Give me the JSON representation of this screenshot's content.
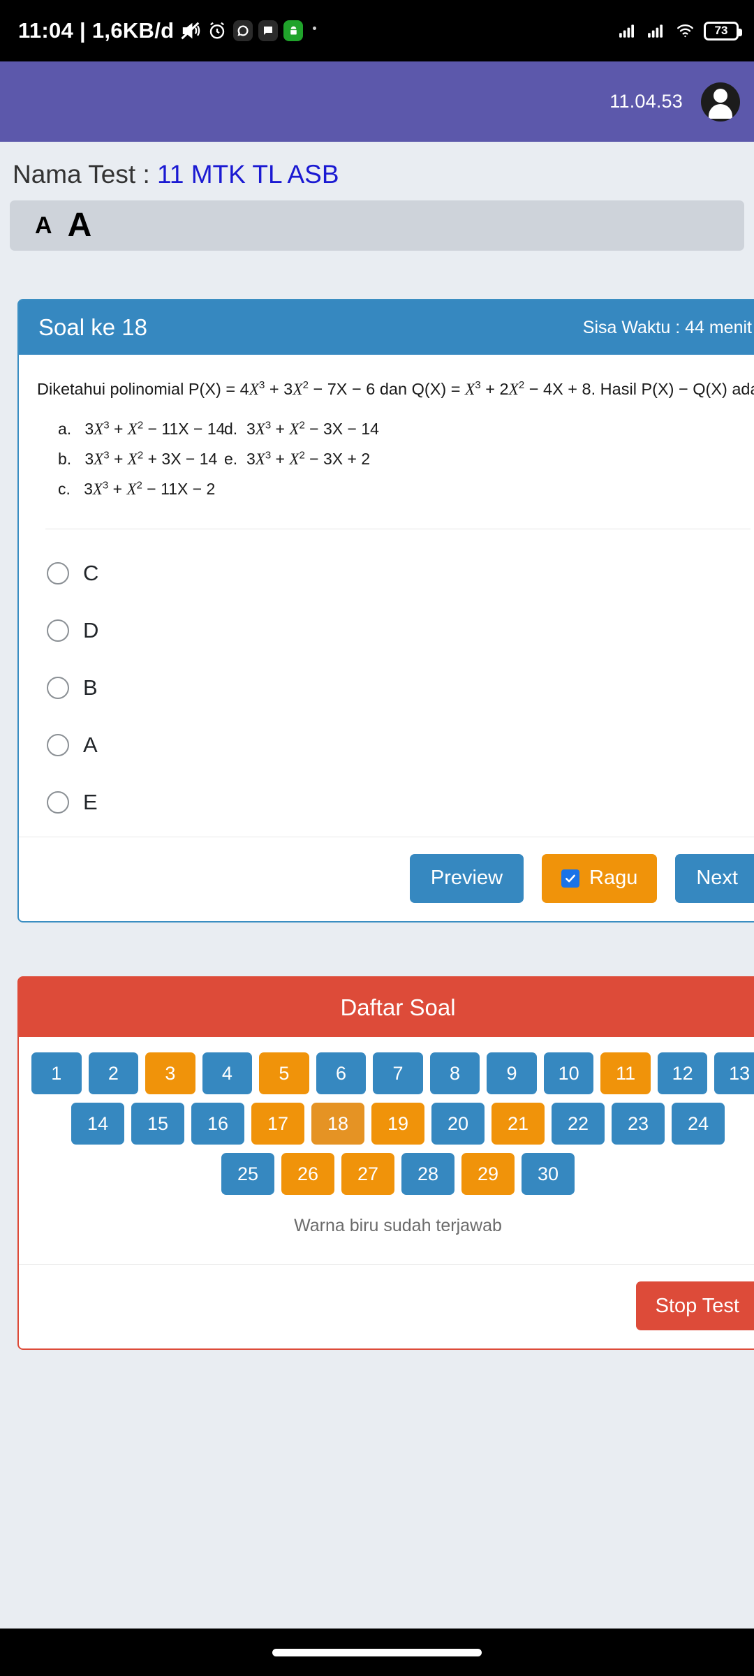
{
  "statusbar": {
    "clock": "11:04 | 1,6KB/d",
    "icons": [
      "mute-icon",
      "alarm-icon",
      "whatsapp-icon",
      "chat-icon",
      "android-icon"
    ],
    "battery_level": "73",
    "signal_icons": [
      "signal-bars-icon",
      "signal-bars-icon",
      "wifi-icon"
    ]
  },
  "appbar": {
    "time": "11.04.53",
    "avatar": "user-avatar-icon"
  },
  "test": {
    "name_label": "Nama Test : ",
    "name_value": "11 MTK TL ASB"
  },
  "fontbar": {
    "decrease_label": "A",
    "increase_label": "A"
  },
  "question_card": {
    "title": "Soal ke 18",
    "timer": "Sisa Waktu : 44 menit",
    "question_html": "Diketahui polinomial P(X) = 4<i>X</i><sup>3</sup> + 3<i>X</i><sup>2</sup> &minus; 7X &minus; 6 dan Q(X) = <i>X</i><sup>3</sup> + 2<i>X</i><sup>2</sup> &minus;  4X + 8. Hasil P(X) &minus; Q(X) adalah ...",
    "question_text": "Diketahui polinomial P(X) = 4X3 + 3X2 − 7X − 6 dan Q(X) = X3 + 2X2 − 4X + 8. Hasil P(X) − Q(X) adalah ...",
    "choices": [
      {
        "key": "a.",
        "html": "3<i>X</i><sup>3</sup> + <i>X</i><sup>2</sup> &minus; 11X &minus; 14",
        "text": "3X3 + X2 − 11X − 14"
      },
      {
        "key": "b.",
        "html": "3<i>X</i><sup>3</sup> + <i>X</i><sup>2</sup> + 3X &minus; 14",
        "text": "3X3 + X2 + 3X − 14"
      },
      {
        "key": "c.",
        "html": "3<i>X</i><sup>3</sup> + <i>X</i><sup>2</sup> &minus; 11X &minus; 2",
        "text": "3X3 + X2 − 11X − 2"
      },
      {
        "key": "d.",
        "html": "3<i>X</i><sup>3</sup> + <i>X</i><sup>2</sup> &minus; 3X &minus; 14",
        "text": "3X3 + X2 − 3X − 14"
      },
      {
        "key": "e.",
        "html": "3<i>X</i><sup>3</sup> + <i>X</i><sup>2</sup> &minus; 3X + 2",
        "text": "3X3 + X2 − 3X + 2"
      }
    ],
    "answers": [
      {
        "label": "C",
        "selected": false
      },
      {
        "label": "D",
        "selected": false
      },
      {
        "label": "B",
        "selected": false
      },
      {
        "label": "A",
        "selected": false
      },
      {
        "label": "E",
        "selected": false
      }
    ],
    "buttons": {
      "preview": "Preview",
      "ragu": "Ragu",
      "ragu_checked": true,
      "next": "Next"
    }
  },
  "daftar_soal": {
    "title": "Daftar Soal",
    "legend": "Warna biru sudah terjawab",
    "stop_button": "Stop Test",
    "rows": [
      [
        {
          "n": "1",
          "state": "blue"
        },
        {
          "n": "2",
          "state": "blue"
        },
        {
          "n": "3",
          "state": "orange"
        },
        {
          "n": "4",
          "state": "blue"
        },
        {
          "n": "5",
          "state": "orange"
        },
        {
          "n": "6",
          "state": "blue"
        },
        {
          "n": "7",
          "state": "blue"
        },
        {
          "n": "8",
          "state": "blue"
        },
        {
          "n": "9",
          "state": "blue"
        },
        {
          "n": "10",
          "state": "blue"
        },
        {
          "n": "11",
          "state": "orange"
        },
        {
          "n": "12",
          "state": "blue"
        },
        {
          "n": "13",
          "state": "blue"
        }
      ],
      [
        {
          "n": "14",
          "state": "blue"
        },
        {
          "n": "15",
          "state": "blue"
        },
        {
          "n": "16",
          "state": "blue"
        },
        {
          "n": "17",
          "state": "orange"
        },
        {
          "n": "18",
          "state": "current"
        },
        {
          "n": "19",
          "state": "orange"
        },
        {
          "n": "20",
          "state": "blue"
        },
        {
          "n": "21",
          "state": "orange"
        },
        {
          "n": "22",
          "state": "blue"
        },
        {
          "n": "23",
          "state": "blue"
        },
        {
          "n": "24",
          "state": "blue"
        }
      ],
      [
        {
          "n": "25",
          "state": "blue"
        },
        {
          "n": "26",
          "state": "orange"
        },
        {
          "n": "27",
          "state": "orange"
        },
        {
          "n": "28",
          "state": "blue"
        },
        {
          "n": "29",
          "state": "orange"
        },
        {
          "n": "30",
          "state": "blue"
        }
      ]
    ]
  },
  "colors": {
    "appbar_purple": "#5c58ab",
    "primary_blue": "#3688c0",
    "accent_orange": "#f0930a",
    "current_orange": "#e59324",
    "danger_red": "#dd4b39",
    "page_bg": "#e9edf2",
    "link_blue": "#1a19d2"
  }
}
